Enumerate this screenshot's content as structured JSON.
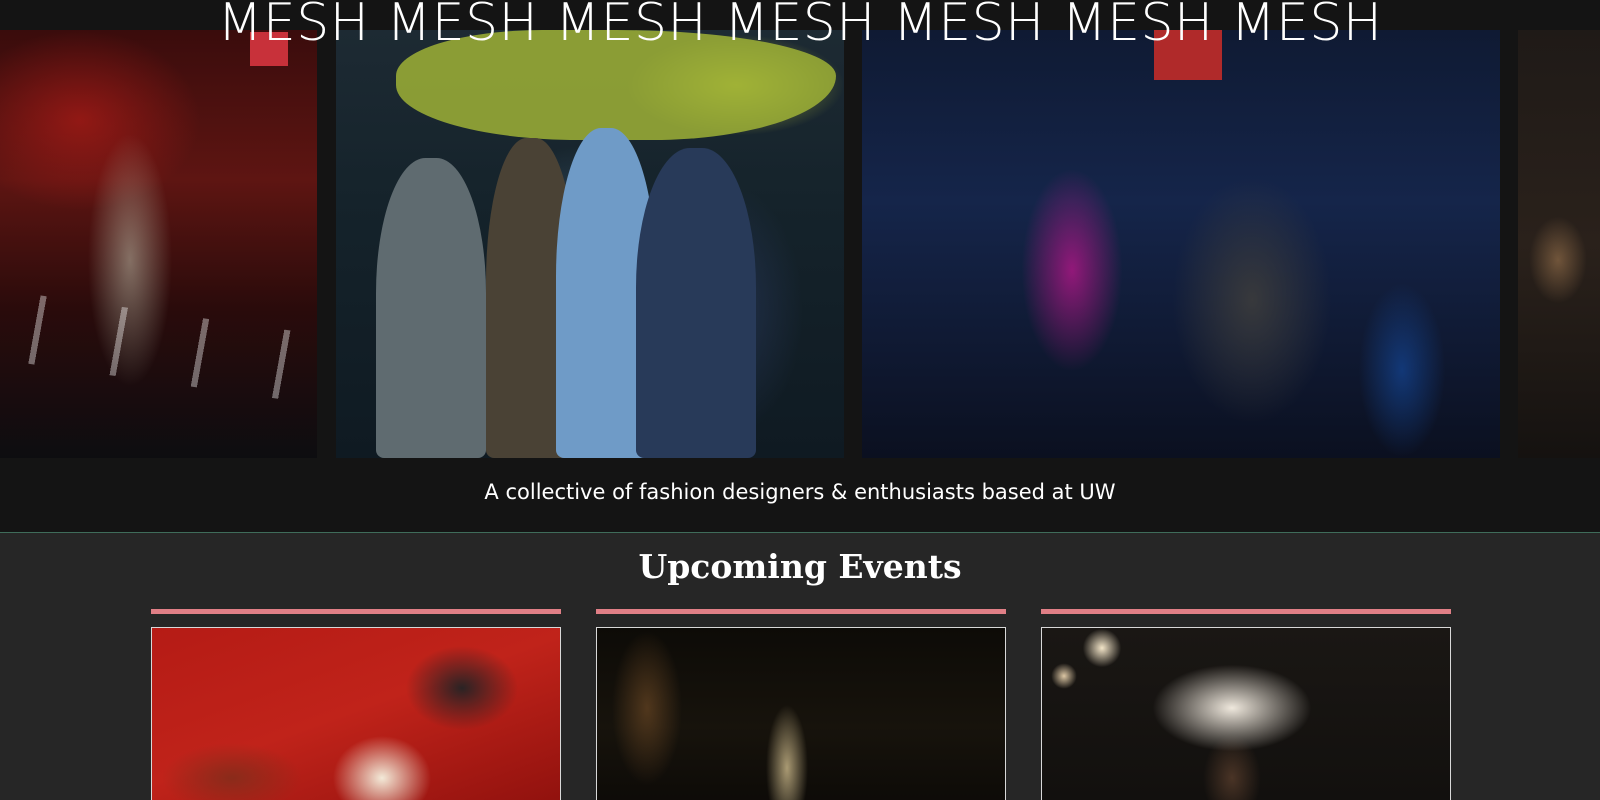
{
  "hero": {
    "title": "MESH MESH MESH MESH MESH MESH MESH",
    "tagline": "A collective of fashion designers & enthusiasts based at UW"
  },
  "events": {
    "heading": "Upcoming Events"
  },
  "colors": {
    "page_background": "#141414",
    "events_background": "#262626",
    "card_accent": "#e07f86",
    "divider": "#3f6c5a",
    "text": "#ffffff"
  }
}
